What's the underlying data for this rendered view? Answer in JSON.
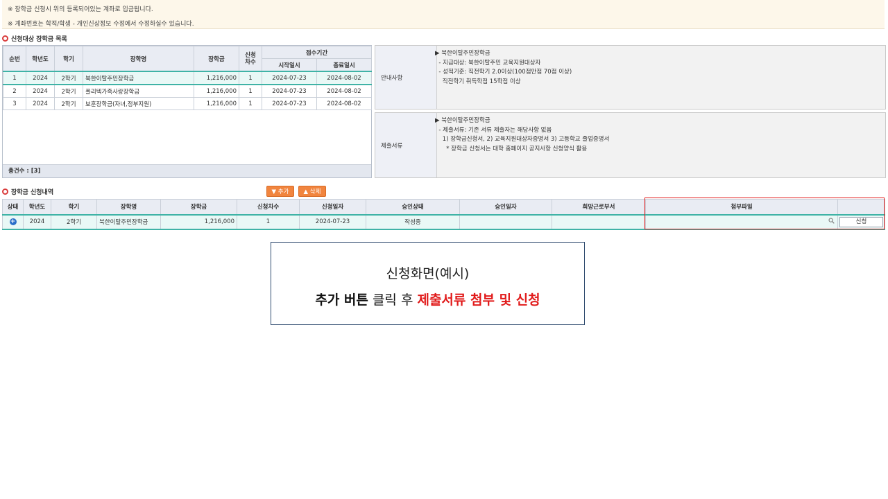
{
  "notice": {
    "line1": "※ 장학금 신청시 위의 등록되어있는 계좌로 입금됩니다.",
    "line2": "※ 계좌번호는 학적/학생 - 개인신상정보 수정에서 수정하실수 있습니다."
  },
  "list_section": {
    "title": "신청대상 장학금 목록",
    "headers": {
      "no": "순번",
      "year": "학년도",
      "term": "학기",
      "name": "장학명",
      "amount": "장학금",
      "round": "신청\n차수",
      "period": "접수기간",
      "start": "시작일시",
      "end": "종료일시"
    },
    "rows": [
      {
        "no": "1",
        "year": "2024",
        "term": "2학기",
        "name": "북한이탈주민장학금",
        "amount": "1,216,000",
        "round": "1",
        "start": "2024-07-23",
        "end": "2024-08-02"
      },
      {
        "no": "2",
        "year": "2024",
        "term": "2학기",
        "name": "폴리텍가족사랑장학금",
        "amount": "1,216,000",
        "round": "1",
        "start": "2024-07-23",
        "end": "2024-08-02"
      },
      {
        "no": "3",
        "year": "2024",
        "term": "2학기",
        "name": "보훈장학금(자녀,정부지원)",
        "amount": "1,216,000",
        "round": "1",
        "start": "2024-07-23",
        "end": "2024-08-02"
      }
    ],
    "total": "총건수 : [3]"
  },
  "guide": {
    "label": "안내사항",
    "text": "▶ 북한이탈주민장학금\n  - 지급대상: 북한이탈주민 교육지원대상자\n  - 성적기준: 직전학기 2.0이상(100점만점 70점 이상)\n    직전학기 취득학점 15학점 이상"
  },
  "docs": {
    "label": "제출서류",
    "text": "▶ 북한이탈주민장학금\n  - 제출서류: 기존 서류 제출자는 해당사항 없음\n    1) 장학금신청서, 2) 교육지원대상자증명서 3) 고등학교 졸업증명서\n      * 장학금 신청서는 대학 홈페이지 공지사항 신청양식 활용"
  },
  "apply_section": {
    "title": "장학금 신청내역",
    "add_label": "▼ 추가",
    "delete_label": "▲ 삭제",
    "headers": {
      "status": "상태",
      "year": "학년도",
      "term": "학기",
      "name": "장학명",
      "amount": "장학금",
      "round": "신청차수",
      "date": "신청일자",
      "approval": "승인상태",
      "approval_date": "승인일자",
      "dept": "희망근로부서",
      "file": "첨부파일"
    },
    "row": {
      "year": "2024",
      "term": "2학기",
      "name": "북한이탈주민장학금",
      "amount": "1,216,000",
      "round": "1",
      "date": "2024-07-23",
      "approval": "작성중",
      "approval_date": "",
      "dept": "",
      "file": "",
      "apply_label": "신청"
    }
  },
  "caption": {
    "line1": "신청화면(예시)",
    "line2_a": "추가 버튼",
    "line2_b": " 클릭 후 ",
    "line2_c": "제출서류 첨부 및 신청"
  },
  "colors": {
    "accent_orange": "#f1853f",
    "selected_row": "#3fb3a6",
    "highlight_box": "#e11a1a"
  }
}
